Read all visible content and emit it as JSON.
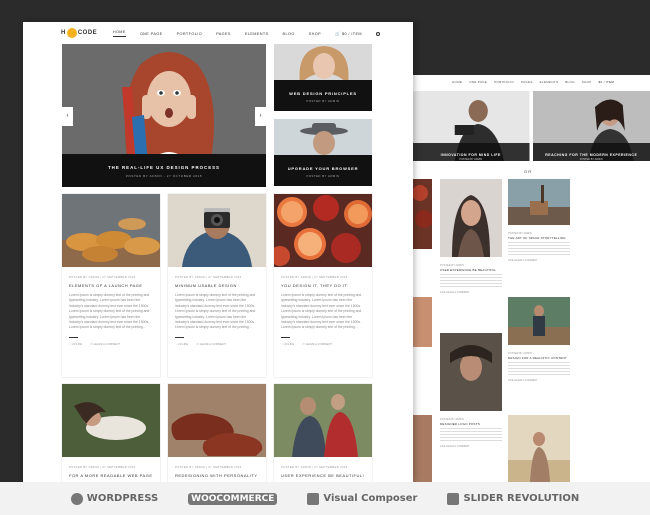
{
  "nav": {
    "logo_left": "H",
    "logo_right": "CODE",
    "items": [
      "HOME",
      "ONE PAGE",
      "PORTFOLIO",
      "PAGES",
      "ELEMENTS",
      "BLOG",
      "SHOP"
    ],
    "cart": "$0 / ITEM"
  },
  "hero": {
    "title": "THE REAL-LIFE UX DESIGN PROCESS",
    "subtitle": "POSTED BY ADMIN - 27 OCTOBER 2015"
  },
  "side_posts": [
    {
      "title": "WEB DESIGN PRINCIPLES",
      "subtitle": "POSTED BY ADMIN"
    },
    {
      "title": "UPGRADE YOUR BROWSER",
      "subtitle": "POSTED BY ADMIN"
    }
  ],
  "cards": [
    {
      "meta": "POSTED BY ADMIN | 27 SEPTEMBER 2015",
      "title": "ELEMENTS OF A LAUNCH PAGE",
      "body": "Lorem Ipsum is simply dummy text of the printing and typesetting industry. Lorem Ipsum has been the industry's standard dummy text ever since the 1500s. Lorem Ipsum is simply dummy text of the printing and typesetting industry. Lorem Ipsum has been the industry's standard dummy text ever since the 1500s. Lorem Ipsum is simply dummy text of the printing...",
      "likes": "20 LIKE",
      "comment": "LEAVE A COMMENT"
    },
    {
      "meta": "POSTED BY ADMIN | 27 SEPTEMBER 2015",
      "title": "MINIMUM USABLE DESIGN",
      "body": "Lorem Ipsum is simply dummy text of the printing and typesetting industry. Lorem Ipsum has been the industry's standard dummy text ever since the 1500s. Lorem Ipsum is simply dummy text of the printing and typesetting industry. Lorem Ipsum has been the industry's standard dummy text ever since the 1500s. Lorem Ipsum is simply dummy text of the printing...",
      "likes": "20 LIKE",
      "comment": "LEAVE A COMMENT"
    },
    {
      "meta": "POSTED BY ADMIN | 27 SEPTEMBER 2015",
      "title": "YOU DESIGN IT, THEY DO IT",
      "body": "Lorem Ipsum is simply dummy text of the printing and typesetting industry. Lorem Ipsum has been the industry's standard dummy text ever since the 1500s. Lorem Ipsum is simply dummy text of the printing and typesetting industry. Lorem Ipsum has been the industry's standard dummy text ever since the 1500s. Lorem Ipsum is simply dummy text of the printing...",
      "likes": "20 LIKE",
      "comment": "LEAVE A COMMENT"
    }
  ],
  "cards_row2": [
    {
      "meta": "POSTED BY ADMIN | 27 SEPTEMBER 2015",
      "title": "FOR A MORE READABLE WEB PAGE"
    },
    {
      "meta": "POSTED BY ADMIN | 27 SEPTEMBER 2015",
      "title": "REDESIGNING WITH PERSONALITY"
    },
    {
      "meta": "POSTED BY ADMIN | 27 SEPTEMBER 2015",
      "title": "USER EXPERIENCE BE BEAUTIFUL!"
    }
  ],
  "back": {
    "nav": [
      "HOME",
      "ONE PAGE",
      "PORTFOLIO",
      "PAGES",
      "ELEMENTS",
      "BLOG",
      "SHOP"
    ],
    "cart": "$0 / ITEM",
    "slides": [
      {
        "title": "INNOVATION FOR MIND LIFE",
        "subtitle": "POSTED BY ADMIN"
      },
      {
        "title": "REACHING FOR THE MODERN EXPERIENCE",
        "subtitle": "POSTED BY ADMIN"
      }
    ],
    "separator": "O R",
    "posts": [
      {
        "meta": "POSTED BY ADMIN",
        "title": "USER EXPERIENCE BE BEAUTIFUL"
      },
      {
        "meta": "POSTED BY ADMIN",
        "title": "THE ART OF SPACE STORYTELLING"
      },
      {
        "meta": "POSTED BY ADMIN",
        "title": "DESIGN FOR A REALISTIC CONTENT"
      },
      {
        "meta": "POSTED BY ADMIN",
        "title": "DESIGNED LOGO POSTS"
      }
    ],
    "foot": "LIKE   LEAVE A COMMENT"
  },
  "partners": [
    "WORDPRESS",
    "WOOCOMMERCE",
    "Visual Composer",
    "SLIDER REVOLUTION"
  ],
  "colors": {
    "accent": "#f5b21e",
    "dark_band": "#111111",
    "background": "#2b2b2b"
  }
}
